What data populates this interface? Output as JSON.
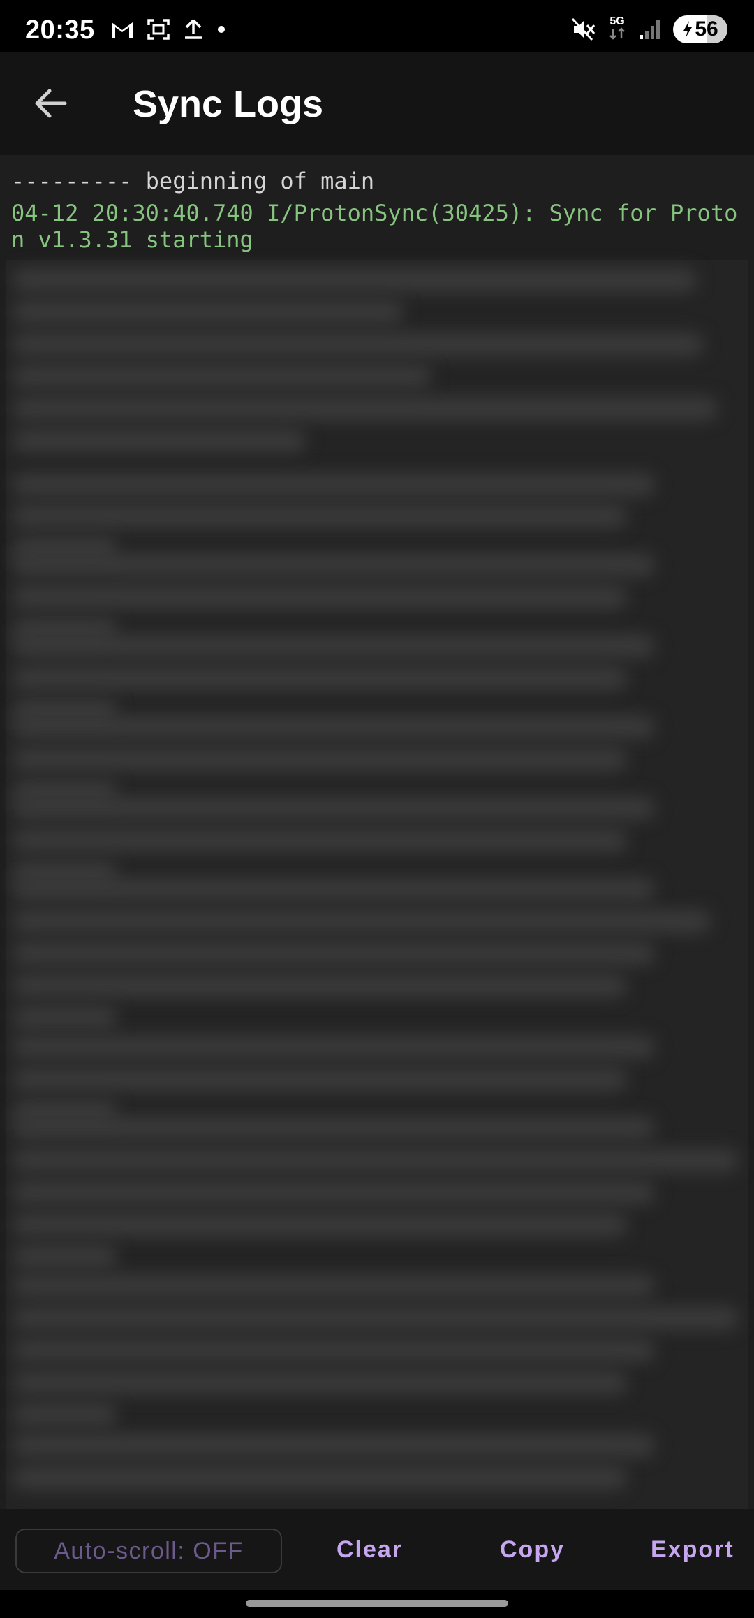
{
  "status_bar": {
    "time": "20:35",
    "network": "5G",
    "battery": "56",
    "icons_left": [
      "gmail-icon",
      "screenshot-icon",
      "upload-icon",
      "dot-icon"
    ],
    "icons_right": [
      "mute-icon",
      "5g-icon",
      "signal-icon",
      "battery-icon"
    ]
  },
  "app_bar": {
    "title": "Sync Logs",
    "back_icon": "arrow-left-icon"
  },
  "log": {
    "divider": "--------- beginning of main",
    "first_entry": "04-12 20:30:40.740 I/ProtonSync(30425): Sync for Proton v1.3.31 starting"
  },
  "bottom_bar": {
    "autoscroll_label": "Auto-scroll: OFF",
    "clear_label": "Clear",
    "copy_label": "Copy",
    "export_label": "Export"
  },
  "colors": {
    "accent": "#c7a6f0",
    "log_green": "#86c47f",
    "background": "#1e1e1e"
  }
}
